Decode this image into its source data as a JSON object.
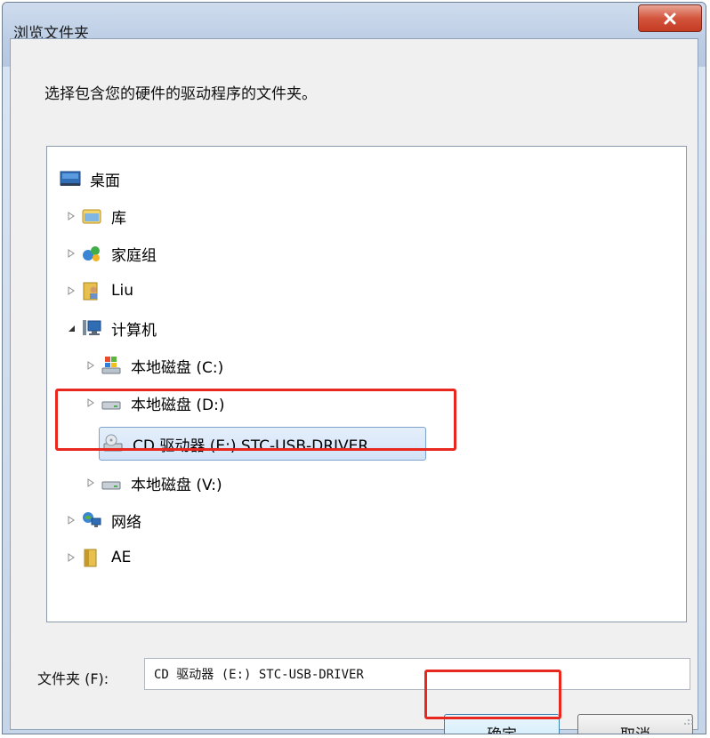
{
  "window": {
    "title": "浏览文件夹",
    "close_glyph": "x"
  },
  "instruction": "选择包含您的硬件的驱动程序的文件夹。",
  "tree": {
    "items": [
      {
        "label": "桌面",
        "icon": "desktop-icon",
        "expander": "none"
      },
      {
        "label": "库",
        "icon": "library-icon",
        "expander": "collapsed"
      },
      {
        "label": "家庭组",
        "icon": "homegroup-icon",
        "expander": "collapsed"
      },
      {
        "label": "Liu",
        "icon": "user-folder-icon",
        "expander": "collapsed"
      },
      {
        "label": "计算机",
        "icon": "computer-icon",
        "expander": "expanded"
      },
      {
        "label": "本地磁盘 (C:)",
        "icon": "system-drive-icon",
        "expander": "collapsed"
      },
      {
        "label": "本地磁盘 (D:)",
        "icon": "drive-icon",
        "expander": "collapsed"
      },
      {
        "label": "CD 驱动器 (E:) STC-USB-DRIVER",
        "icon": "cd-drive-icon",
        "expander": "none",
        "selected": true
      },
      {
        "label": "本地磁盘 (V:)",
        "icon": "drive-icon",
        "expander": "collapsed"
      },
      {
        "label": "网络",
        "icon": "network-icon",
        "expander": "collapsed"
      },
      {
        "label": "AE",
        "icon": "folder-icon",
        "expander": "collapsed"
      }
    ]
  },
  "folder_field": {
    "label": "文件夹 (F):",
    "value": "CD 驱动器 (E:) STC-USB-DRIVER"
  },
  "buttons": {
    "ok": "确定",
    "cancel": "取消"
  },
  "colors": {
    "highlight_box": "#e8281f",
    "selection_fill": "#d2e3f8"
  }
}
